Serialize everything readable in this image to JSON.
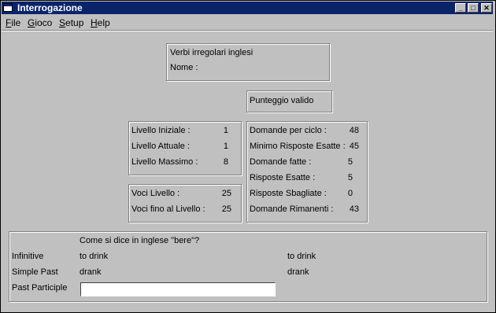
{
  "window": {
    "title": "Interrogazione"
  },
  "menu": [
    {
      "pre": "",
      "key": "F",
      "post": "ile"
    },
    {
      "pre": "",
      "key": "G",
      "post": "ioco"
    },
    {
      "pre": "",
      "key": "S",
      "post": "etup"
    },
    {
      "pre": "",
      "key": "H",
      "post": "elp"
    }
  ],
  "info": {
    "title": "Verbi irregolari inglesi",
    "name_label": "Nome :"
  },
  "score": {
    "label": "Punteggio valido"
  },
  "levels": {
    "initial_label": "Livello Iniziale :",
    "initial_value": "1",
    "current_label": "Livello Attuale :",
    "current_value": "1",
    "max_label": "Livello Massimo  :",
    "max_value": "8"
  },
  "voci": {
    "level_label": "Voci Livello     :",
    "level_value": "25",
    "upto_label": "Voci fino al Livello :",
    "upto_value": "25"
  },
  "stats": {
    "per_cycle_label": "Domande per ciclo :",
    "per_cycle_value": "48",
    "min_correct_label": "Minimo Risposte Esatte :",
    "min_correct_value": "45",
    "asked_label": "Domande fatte :",
    "asked_value": "5",
    "correct_label": "Risposte Esatte :",
    "correct_value": "5",
    "wrong_label": "Risposte Sbagliate :",
    "wrong_value": "0",
    "remaining_label": "Domande Rimanenti :",
    "remaining_value": "43"
  },
  "question": {
    "prompt": "Come si dice in inglese \"bere\"?",
    "infinitive_label": "Infinitive",
    "infinitive_value": "to drink",
    "infinitive_answer": "to drink",
    "simple_past_label": "Simple Past",
    "simple_past_value": "drank",
    "simple_past_answer": "drank",
    "past_participle_label": "Past Participle",
    "past_participle_value": ""
  }
}
